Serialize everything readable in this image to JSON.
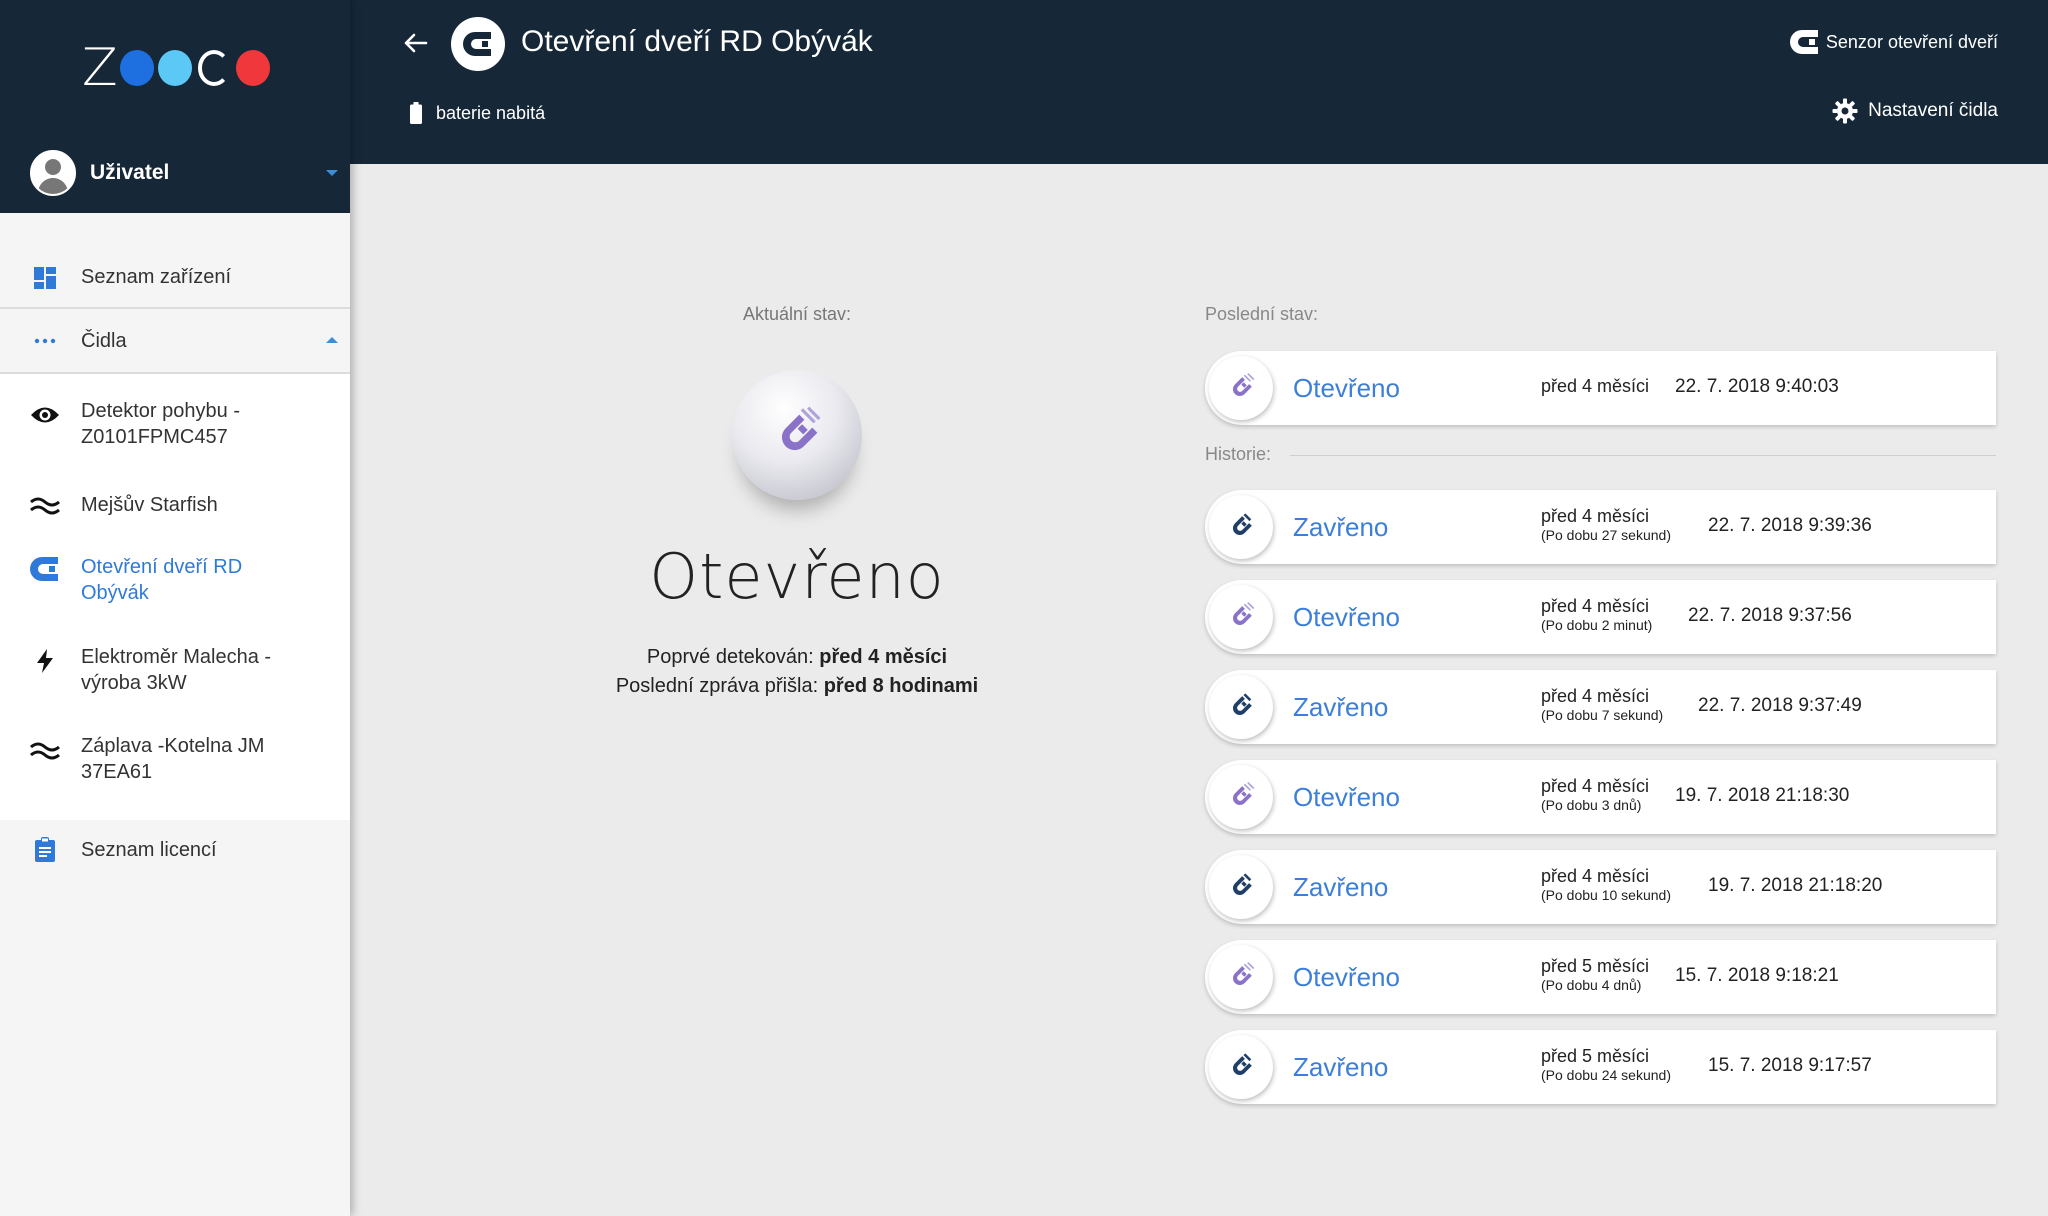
{
  "brand": {
    "logo_z": "Z",
    "colors": {
      "dot1": "#1e6fe0",
      "dot2": "#5bc8f5",
      "dot3": "#f0373b",
      "header_bg": "#162838",
      "accent": "#3d7fd6"
    }
  },
  "user": {
    "name": "Uživatel"
  },
  "sidebar": {
    "device_list": "Seznam zařízení",
    "sensors": "Čidla",
    "items": [
      {
        "label": "Detektor pohybu - Z0101FPMC457",
        "icon": "eye-icon"
      },
      {
        "label": "Mejšův Starfish",
        "icon": "wave-icon"
      },
      {
        "label": "Otevření dveří RD Obývák",
        "icon": "magnet-icon"
      },
      {
        "label": "Elektroměr Malecha - výroba 3kW",
        "icon": "bolt-icon"
      },
      {
        "label": "Záplava -Kotelna JM 37EA61",
        "icon": "wave-icon"
      }
    ],
    "licences": "Seznam licencí"
  },
  "header": {
    "title": "Otevření dveří RD Obývák",
    "battery": "baterie nabitá",
    "sensor_type": "Senzor otevření dveří",
    "settings": "Nastavení čidla"
  },
  "current": {
    "label": "Aktuální stav:",
    "state": "Otevřeno",
    "first_label": "Poprvé detekován:",
    "first_value": "před 4 měsíci",
    "last_label": "Poslední zpráva přišla:",
    "last_value": "před 8 hodinami"
  },
  "last": {
    "label": "Poslední stav:",
    "state": "Otevřeno",
    "ago": "před 4 měsíci",
    "date": "22. 7. 2018 9:40:03"
  },
  "history": {
    "label": "Historie:",
    "items": [
      {
        "state": "Zavřeno",
        "ago": "před 4 měsíci",
        "duration": "(Po dobu 27 sekund)",
        "date": "22. 7. 2018 9:39:36"
      },
      {
        "state": "Otevřeno",
        "ago": "před 4 měsíci",
        "duration": "(Po dobu 2 minut)",
        "date": "22. 7. 2018 9:37:56"
      },
      {
        "state": "Zavřeno",
        "ago": "před 4 měsíci",
        "duration": "(Po dobu 7 sekund)",
        "date": "22. 7. 2018 9:37:49"
      },
      {
        "state": "Otevřeno",
        "ago": "před 4 měsíci",
        "duration": "(Po dobu 3 dnů)",
        "date": "19. 7. 2018 21:18:30"
      },
      {
        "state": "Zavřeno",
        "ago": "před 4 měsíci",
        "duration": "(Po dobu 10 sekund)",
        "date": "19. 7. 2018 21:18:20"
      },
      {
        "state": "Otevřeno",
        "ago": "před 5 měsíci",
        "duration": "(Po dobu 4 dnů)",
        "date": "15. 7. 2018 9:18:21"
      },
      {
        "state": "Zavřeno",
        "ago": "před 5 měsíci",
        "duration": "(Po dobu 24 sekund)",
        "date": "15. 7. 2018 9:17:57"
      }
    ]
  }
}
